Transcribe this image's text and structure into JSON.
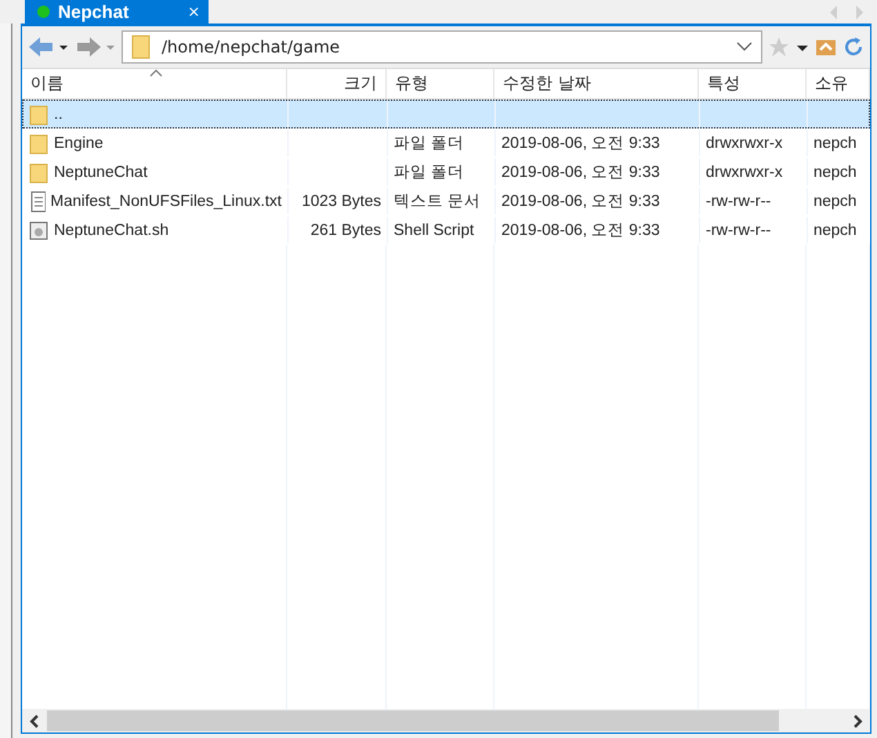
{
  "tab": {
    "title": "Nepchat",
    "close": "×"
  },
  "address": {
    "value": "/home/nepchat/game"
  },
  "columns": [
    "이름",
    "크기",
    "유형",
    "수정한 날짜",
    "특성",
    "소유"
  ],
  "rows": [
    {
      "kind": "folder",
      "selected": true,
      "cells": [
        "..",
        "",
        "",
        "",
        "",
        ""
      ]
    },
    {
      "kind": "folder",
      "selected": false,
      "cells": [
        "Engine",
        "",
        "파일 폴더",
        "2019-08-06, 오전 9:33",
        "drwxrwxr-x",
        "nepch"
      ]
    },
    {
      "kind": "folder",
      "selected": false,
      "cells": [
        "NeptuneChat",
        "",
        "파일 폴더",
        "2019-08-06, 오전 9:33",
        "drwxrwxr-x",
        "nepch"
      ]
    },
    {
      "kind": "text",
      "selected": false,
      "cells": [
        "Manifest_NonUFSFiles_Linux.txt",
        "1023 Bytes",
        "텍스트 문서",
        "2019-08-06, 오전 9:33",
        "-rw-rw-r--",
        "nepch"
      ]
    },
    {
      "kind": "script",
      "selected": false,
      "cells": [
        "NeptuneChat.sh",
        "261 Bytes",
        "Shell Script",
        "2019-08-06, 오전 9:33",
        "-rw-rw-r--",
        "nepch"
      ]
    }
  ]
}
